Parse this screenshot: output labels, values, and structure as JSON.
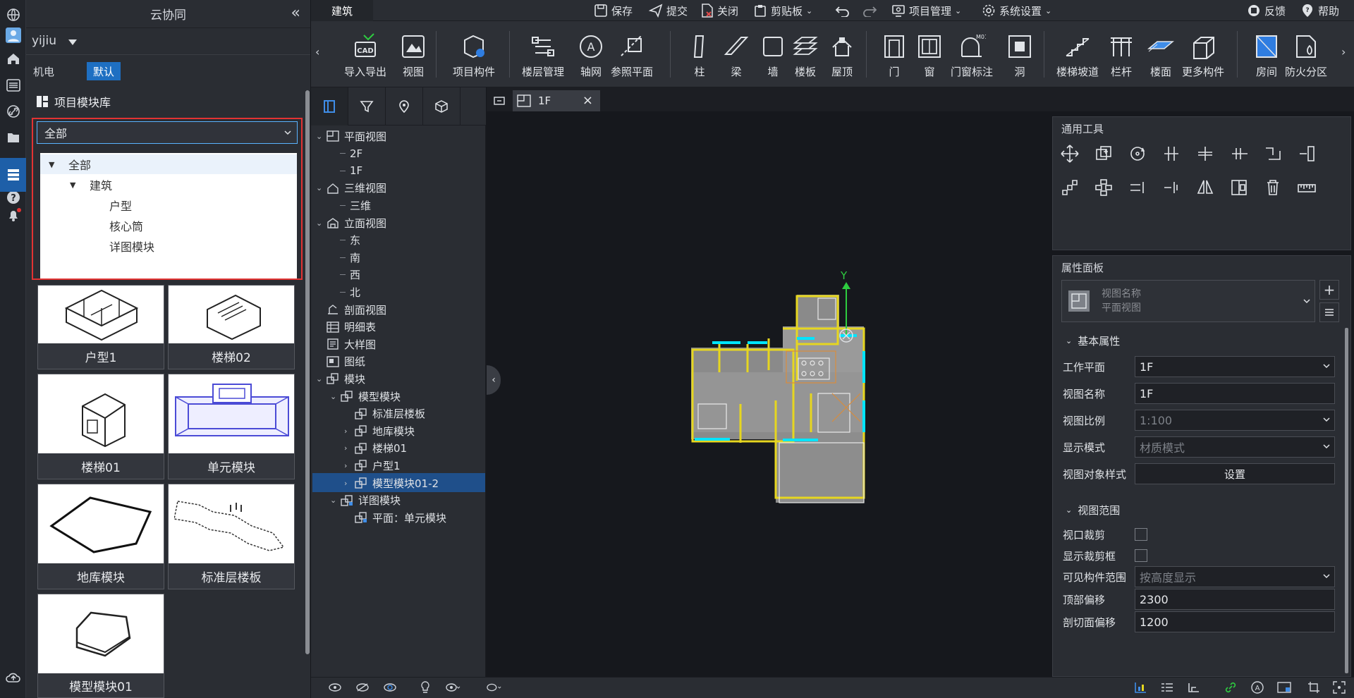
{
  "app": {
    "title": "云协同",
    "collapse_glyph": "«"
  },
  "user": {
    "name": "yijiu"
  },
  "discipline": {
    "label": "机电",
    "badge": "默认"
  },
  "library": {
    "title": "项目模块库",
    "filter_value": "全部",
    "dropdown": [
      {
        "label": "全部",
        "level": 0,
        "expanded": true
      },
      {
        "label": "建筑",
        "level": 1,
        "expanded": true
      },
      {
        "label": "户型",
        "level": 2
      },
      {
        "label": "核心筒",
        "level": 2
      },
      {
        "label": "详图模块",
        "level": 2
      }
    ],
    "tiles": [
      {
        "label": "户型1"
      },
      {
        "label": "楼梯02"
      },
      {
        "label": "楼梯01"
      },
      {
        "label": "单元模块"
      },
      {
        "label": "地库模块"
      },
      {
        "label": "标准层楼板"
      },
      {
        "label": "模型模块01"
      }
    ]
  },
  "topbar": {
    "tab": "建筑",
    "items": [
      {
        "label": "保存",
        "icon": "save-icon"
      },
      {
        "label": "提交",
        "icon": "submit-icon"
      },
      {
        "label": "关闭",
        "icon": "close-file-icon"
      },
      {
        "label": "剪贴板",
        "icon": "clipboard-icon"
      },
      {
        "label": "项目管理",
        "icon": "project-manage-icon"
      },
      {
        "label": "系统设置",
        "icon": "settings-icon"
      },
      {
        "label": "反馈",
        "icon": "feedback-icon"
      },
      {
        "label": "帮助",
        "icon": "help-icon"
      }
    ]
  },
  "ribbon": [
    {
      "label": "导入导出",
      "icon": "cad-import-icon"
    },
    {
      "label": "视图",
      "icon": "view-icon"
    },
    {
      "label": "项目构件",
      "icon": "project-component-icon"
    },
    {
      "label": "楼层管理",
      "icon": "floor-manage-icon"
    },
    {
      "label": "轴网",
      "icon": "axis-grid-icon"
    },
    {
      "label": "参照平面",
      "icon": "reference-plane-icon"
    },
    {
      "label": "柱",
      "icon": "column-icon"
    },
    {
      "label": "梁",
      "icon": "beam-icon"
    },
    {
      "label": "墙",
      "icon": "wall-icon"
    },
    {
      "label": "楼板",
      "icon": "slab-icon"
    },
    {
      "label": "屋顶",
      "icon": "roof-icon"
    },
    {
      "label": "门",
      "icon": "door-icon"
    },
    {
      "label": "窗",
      "icon": "window-icon"
    },
    {
      "label": "门窗标注",
      "icon": "door-window-tag-icon"
    },
    {
      "label": "洞",
      "icon": "opening-icon"
    },
    {
      "label": "楼梯坡道",
      "icon": "stair-ramp-icon"
    },
    {
      "label": "栏杆",
      "icon": "railing-icon"
    },
    {
      "label": "楼面",
      "icon": "floor-surface-icon"
    },
    {
      "label": "更多构件",
      "icon": "more-components-icon"
    },
    {
      "label": "房间",
      "icon": "room-icon"
    },
    {
      "label": "防火分区",
      "icon": "fire-zone-icon"
    }
  ],
  "ribbon_tag_text": {
    "cad": "CAD",
    "m01": "M01"
  },
  "project_tree": [
    {
      "label": "平面视图",
      "level": 0,
      "caret": "v",
      "icon": "plan-view-icon"
    },
    {
      "label": "2F",
      "level": 1
    },
    {
      "label": "1F",
      "level": 1
    },
    {
      "label": "三维视图",
      "level": 0,
      "caret": "v",
      "icon": "3d-view-icon"
    },
    {
      "label": "三维",
      "level": 1
    },
    {
      "label": "立面视图",
      "level": 0,
      "caret": "v",
      "icon": "elevation-view-icon"
    },
    {
      "label": "东",
      "level": 1
    },
    {
      "label": "南",
      "level": 1
    },
    {
      "label": "西",
      "level": 1
    },
    {
      "label": "北",
      "level": 1
    },
    {
      "label": "剖面视图",
      "level": 0,
      "icon": "section-view-icon"
    },
    {
      "label": "明细表",
      "level": 0,
      "icon": "schedule-icon"
    },
    {
      "label": "大样图",
      "level": 0,
      "icon": "detail-view-icon"
    },
    {
      "label": "图纸",
      "level": 0,
      "icon": "sheet-icon"
    },
    {
      "label": "模块",
      "level": 0,
      "caret": "v",
      "icon": "module-icon"
    },
    {
      "label": "模型模块",
      "level": 1,
      "caret": "v",
      "icon": "module-icon"
    },
    {
      "label": "标准层楼板",
      "level": 2,
      "icon": "module-icon"
    },
    {
      "label": "地库模块",
      "level": 2,
      "caret": ">",
      "icon": "module-icon"
    },
    {
      "label": "楼梯01",
      "level": 2,
      "caret": ">",
      "icon": "module-icon"
    },
    {
      "label": "户型1",
      "level": 2,
      "caret": ">",
      "icon": "module-icon"
    },
    {
      "label": "模型模块01-2",
      "level": 2,
      "caret": ">",
      "icon": "module-icon",
      "selected": true
    },
    {
      "label": "详图模块",
      "level": 1,
      "caret": "v",
      "icon": "detail-module-icon"
    },
    {
      "label": "平面：单元模块",
      "level": 2,
      "icon": "detail-module-icon"
    }
  ],
  "doc_tab": {
    "label": "1F"
  },
  "canvas": {
    "axis_label": "Y"
  },
  "tools_panel": {
    "title": "通用工具"
  },
  "props_panel": {
    "title": "属性面板",
    "view_card": {
      "line1": "视图名称",
      "line2": "平面视图"
    },
    "section_basic": "基本属性",
    "rows": [
      {
        "label": "工作平面",
        "value": "1F",
        "type": "select"
      },
      {
        "label": "视图名称",
        "value": "1F",
        "type": "input"
      },
      {
        "label": "视图比例",
        "value": "1:100",
        "type": "select-disabled"
      },
      {
        "label": "显示模式",
        "value": "材质模式",
        "type": "select-disabled"
      },
      {
        "label": "视图对象样式",
        "value": "设置",
        "type": "button"
      }
    ],
    "section_range": "视图范围",
    "range_rows": [
      {
        "label": "视口裁剪",
        "type": "checkbox"
      },
      {
        "label": "显示裁剪框",
        "type": "checkbox"
      },
      {
        "label": "可见构件范围",
        "value": "按高度显示",
        "type": "select-disabled"
      },
      {
        "label": "顶部偏移",
        "value": "2300",
        "type": "input"
      },
      {
        "label": "剖切面偏移",
        "value": "1200",
        "type": "input"
      }
    ]
  },
  "colors": {
    "accent": "#1e5fa8",
    "selected_tree": "#1f4f8a",
    "highlight_red": "#e23333",
    "axis_green": "#2ecc40",
    "plan_yellow": "#e6d620",
    "plan_cyan": "#00e5ff"
  }
}
